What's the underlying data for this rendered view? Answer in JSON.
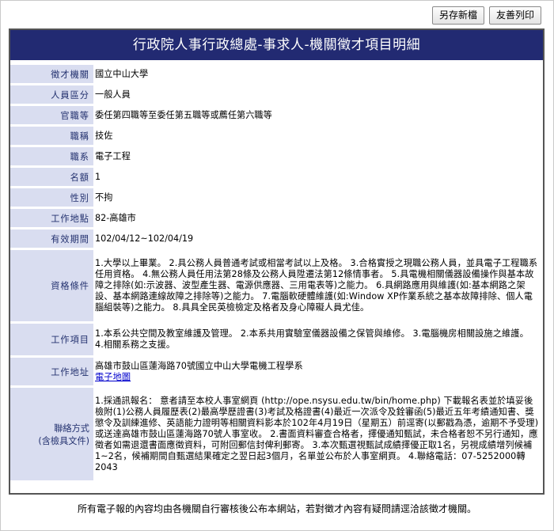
{
  "toolbar": {
    "save_new_label": "另存新檔",
    "print_label": "友善列印"
  },
  "title": "行政院人事行政總處-事求人-機關徵才項目明細",
  "fields": {
    "agency": {
      "label": "徵才機關",
      "value": "國立中山大學"
    },
    "category": {
      "label": "人員區分",
      "value": "一般人員"
    },
    "grade": {
      "label": "官職等",
      "value": "委任第四職等至委任第五職等或薦任第六職等"
    },
    "title": {
      "label": "職稱",
      "value": "技佐"
    },
    "series": {
      "label": "職系",
      "value": "電子工程"
    },
    "quota": {
      "label": "名額",
      "value": "1"
    },
    "gender": {
      "label": "性別",
      "value": "不拘"
    },
    "location": {
      "label": "工作地點",
      "value": "82-高雄市"
    },
    "period": {
      "label": "有效期間",
      "value": "102/04/12~102/04/19"
    },
    "conditions": {
      "label": "資格條件",
      "value": "1.大學以上畢業。 2.具公務人員普通考試或相當考試以上及格。 3.合格實授之現職公務人員，並具電子工程職系任用資格。 4.無公務人員任用法第28條及公務人員陞遷法第12條情事者。 5.具電機相關儀器設備操作與基本故障之排除(如:示波器、波型產生器、電源供應器、三用電表等)之能力。 6.具網路應用與維護(如:基本網路之架設、基本網路連線故障之排除等)之能力。 7.電腦軟硬體維護(如:Window XP作業系統之基本故障排除、個人電腦組裝等)之能力。 8.具具全民英檢檢定及格者及身心障礙人員尤佳。"
    },
    "items": {
      "label": "工作項目",
      "value": "1.本系公共空間及教室維護及管理。 2.本系共用實驗室儀器設備之保管與維修。 3.電腦機房相關設施之維護。 4.相關系務之支援。"
    },
    "address": {
      "label": "工作地址",
      "value": "高雄市鼓山區蓮海路70號國立中山大學電機工程學系",
      "map_link": "電子地圖"
    },
    "contact": {
      "label": "聯絡方式",
      "label2": "(含檢具文件)",
      "value": "1.採通訊報名： 意者請至本校人事室網頁 (http://ope.nsysu.edu.tw/bin/home.php) 下載報名表並於填妥後檢附(1)公務人員履歷表(2)最高學歷證書(3)考試及格證書(4)最近一次派令及銓審函(5)最近五年考績通知書、獎懲令及訓練進修、英語能力證明等相關資料影本於102年4月19日（星期五）前逕寄(以郵戳為憑，逾期不予受理)或送達高雄市鼓山區蓮海路70號人事室收。 2.書面資料審查合格者，擇優通知甄試，未合格者恕不另行通知，應徵者如需退還書面應徵資料，可附回郵信封俾利郵寄。 3.本次甄選視甄試成績擇優正取1名，另視成績增列候補1~2名，候補期間自甄選結果確定之翌日起3個月，名單並公布於人事室網頁。 4.聯絡電話：07-5252000轉2043"
    }
  },
  "footer": "所有電子報的內容均由各機關自行審核後公布本網站，若對徵才內容有疑問請逕洽該徵才機關。",
  "colors": {
    "title_bg": "#222a72",
    "label_bg": "#d9ddf0",
    "label_text": "#22306e"
  }
}
